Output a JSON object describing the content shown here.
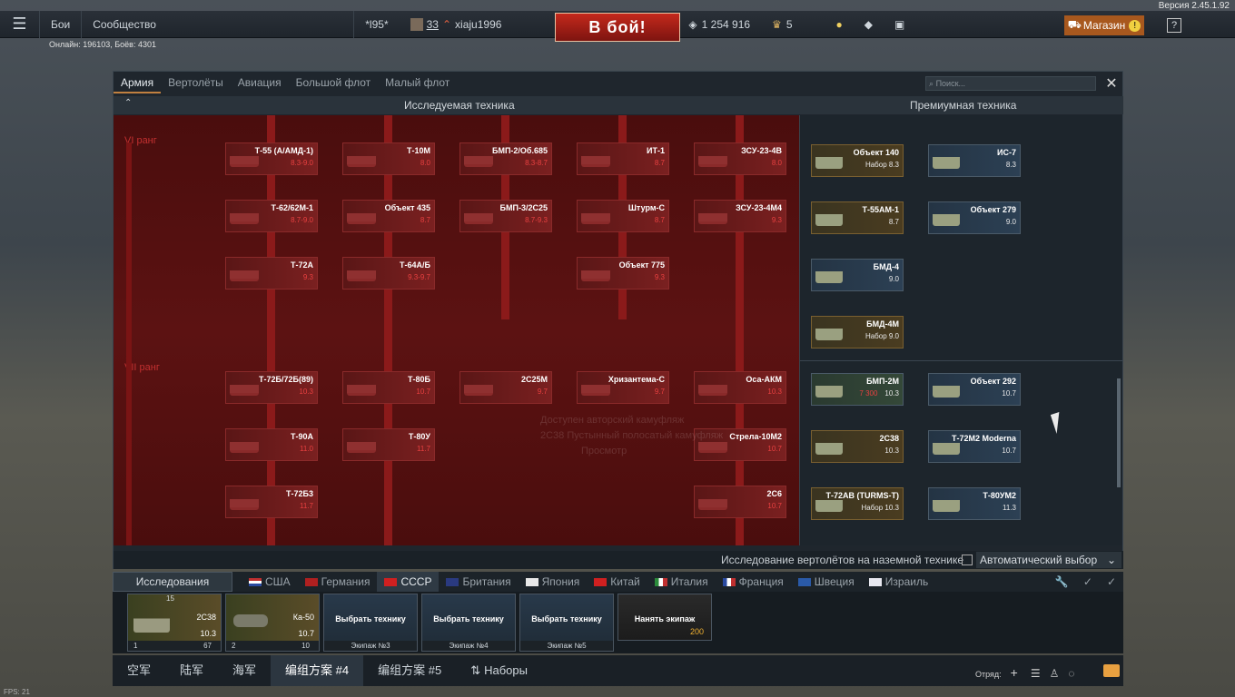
{
  "version": "Версия 2.45.1.92",
  "topbar": {
    "battles": "Бои",
    "community": "Сообщество",
    "clan_tag": "*l95*",
    "level": "33",
    "username": "xiaju1996",
    "fight_button": "В бой!",
    "silver": "1 254 916",
    "gold": "5",
    "shop": "Магазин"
  },
  "online_line": "Онлайн: 196103, Боёв: 4301",
  "window": {
    "tabs": [
      "Армия",
      "Вертолёты",
      "Авиация",
      "Большой флот",
      "Малый флот"
    ],
    "search_placeholder": "Поиск...",
    "researched_title": "Исследуемая техника",
    "premium_title": "Премиумная техника",
    "rank6": "VI ранг",
    "rank7": "VII ранг",
    "tree": [
      {
        "name": "Т-55 (А/АМД-1)",
        "br": "8.3-9.0"
      },
      {
        "name": "Т-10М",
        "br": "8.0"
      },
      {
        "name": "БМП-2/Об.685",
        "br": "8.3-8.7"
      },
      {
        "name": "ИТ-1",
        "br": "8.7"
      },
      {
        "name": "ЗСУ-23-4В",
        "br": "8.0"
      },
      {
        "name": "Т-62/62М-1",
        "br": "8.7-9.0"
      },
      {
        "name": "Объект 435",
        "br": "8.7"
      },
      {
        "name": "БМП-3/2С25",
        "br": "8.7-9.3"
      },
      {
        "name": "Штурм-С",
        "br": "8.7"
      },
      {
        "name": "ЗСУ-23-4М4",
        "br": "9.3"
      },
      {
        "name": "Т-72А",
        "br": "9.3"
      },
      {
        "name": "Т-64А/Б",
        "br": "9.3-9.7"
      },
      {
        "name": "Объект 775",
        "br": "9.3"
      },
      {
        "name": "Т-72Б/72Б(89)",
        "br": "10.3"
      },
      {
        "name": "Т-80Б",
        "br": "10.7"
      },
      {
        "name": "2С25М",
        "br": "9.7"
      },
      {
        "name": "Хризантема-С",
        "br": "9.7"
      },
      {
        "name": "Оса-АКМ",
        "br": "10.3"
      },
      {
        "name": "Т-90А",
        "br": "11.0"
      },
      {
        "name": "Т-80У",
        "br": "11.7"
      },
      {
        "name": "Стрела-10М2",
        "br": "10.7"
      },
      {
        "name": "Т-72Б3",
        "br": "11.7"
      },
      {
        "name": "2С6",
        "br": "10.7"
      }
    ],
    "premium": [
      {
        "name": "Объект 140",
        "br": "Набор 8.3"
      },
      {
        "name": "ИС-7",
        "br": "8.3"
      },
      {
        "name": "Т-55АМ-1",
        "br": "8.7"
      },
      {
        "name": "Объект 279",
        "br": "9.0"
      },
      {
        "name": "БМД-4",
        "br": "9.0"
      },
      {
        "name": "БМД-4М",
        "br": "Набор 9.0"
      },
      {
        "name": "БМП-2М",
        "br": "10.3",
        "price": "7 300"
      },
      {
        "name": "Объект 292",
        "br": "10.7"
      },
      {
        "name": "2С38",
        "br": "10.3"
      },
      {
        "name": "Т-72М2 Moderna",
        "br": "10.7"
      },
      {
        "name": "Т-72АВ (TURMS-T)",
        "br": "Набор 10.3"
      },
      {
        "name": "Т-80УМ2",
        "br": "11.3"
      }
    ],
    "heli_research": "Исследование вертолётов на наземной технике",
    "auto_select": "Автоматический выбор",
    "ghost": [
      "Доступен авторский камуфляж",
      "2С38 Пустынный полосатый камуфляж",
      "Просмотр"
    ]
  },
  "countries": {
    "research_tab": "Исследования",
    "items": [
      "США",
      "Германия",
      "СССР",
      "Британия",
      "Япония",
      "Китай",
      "Италия",
      "Франция",
      "Швеция",
      "Израиль"
    ],
    "active": "СССР"
  },
  "crew": {
    "slots": [
      {
        "name": "2С38",
        "br": "10.3",
        "num": "1",
        "pts": "67",
        "top": "15"
      },
      {
        "name": "Ка-50",
        "br": "10.7",
        "num": "2",
        "pts": "10"
      },
      {
        "pick": "Выбрать технику",
        "label": "Экипаж №3"
      },
      {
        "pick": "Выбрать технику",
        "label": "Экипаж №4"
      },
      {
        "pick": "Выбрать технику",
        "label": "Экипаж №5"
      },
      {
        "pick": "Нанять экипаж",
        "price": "200"
      }
    ]
  },
  "bottomnav": {
    "items": [
      "空军",
      "陆军",
      "海军",
      "编组方案 #4",
      "编组方案 #5",
      "Наборы"
    ],
    "squad": "Отряд:"
  },
  "fps": "FPS: 21",
  "colors": {
    "accent": "#c4291c",
    "shop": "#a8581e",
    "tree_bg": "#5c1212"
  }
}
